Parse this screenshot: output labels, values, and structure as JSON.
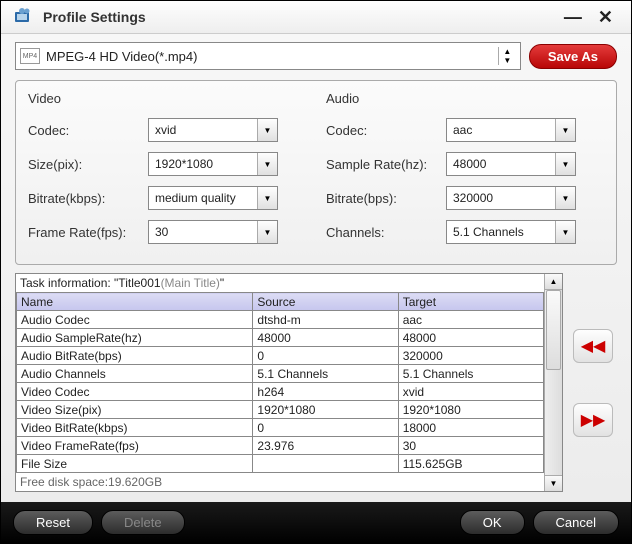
{
  "title": "Profile Settings",
  "profile": {
    "format_label": "MPEG-4 HD Video(*.mp4)",
    "format_badge": "MP4"
  },
  "save_as": "Save As",
  "video": {
    "title": "Video",
    "codec_label": "Codec:",
    "codec": "xvid",
    "size_label": "Size(pix):",
    "size": "1920*1080",
    "bitrate_label": "Bitrate(kbps):",
    "bitrate": "medium quality",
    "framerate_label": "Frame Rate(fps):",
    "framerate": "30"
  },
  "audio": {
    "title": "Audio",
    "codec_label": "Codec:",
    "codec": "aac",
    "samplerate_label": "Sample Rate(hz):",
    "samplerate": "48000",
    "bitrate_label": "Bitrate(bps):",
    "bitrate": "320000",
    "channels_label": "Channels:",
    "channels": "5.1 Channels"
  },
  "task": {
    "prefix": "Task information: ",
    "title": "\"Title001",
    "subtitle": "(Main Title)",
    "suffix": "\"",
    "headers": {
      "name": "Name",
      "source": "Source",
      "target": "Target"
    },
    "rows": [
      {
        "name": "Audio Codec",
        "source": "dtshd-m",
        "target": "aac"
      },
      {
        "name": "Audio SampleRate(hz)",
        "source": "48000",
        "target": "48000"
      },
      {
        "name": "Audio BitRate(bps)",
        "source": "0",
        "target": "320000"
      },
      {
        "name": "Audio Channels",
        "source": "5.1 Channels",
        "target": "5.1 Channels"
      },
      {
        "name": "Video Codec",
        "source": "h264",
        "target": "xvid"
      },
      {
        "name": "Video Size(pix)",
        "source": "1920*1080",
        "target": "1920*1080"
      },
      {
        "name": "Video BitRate(kbps)",
        "source": "0",
        "target": "18000"
      },
      {
        "name": "Video FrameRate(fps)",
        "source": "23.976",
        "target": "30"
      },
      {
        "name": "File Size",
        "source": "",
        "target": "115.625GB"
      }
    ],
    "free_space_label": "Free disk space:",
    "free_space": "19.620GB"
  },
  "footer": {
    "reset": "Reset",
    "delete": "Delete",
    "ok": "OK",
    "cancel": "Cancel"
  }
}
